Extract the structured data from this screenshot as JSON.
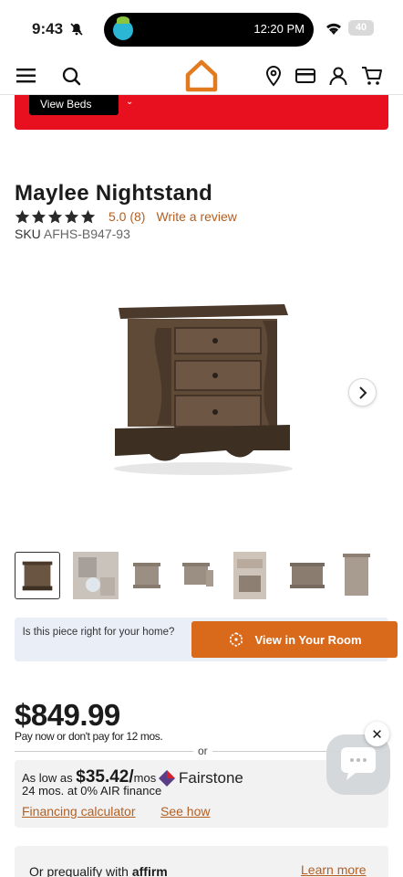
{
  "status_bar": {
    "time": "9:43",
    "island_time": "12:20 PM",
    "battery": "40"
  },
  "nav": {
    "icons": [
      "menu-icon",
      "search-icon",
      "home-logo-icon",
      "location-pin-icon",
      "credit-card-icon",
      "account-icon",
      "cart-icon"
    ],
    "brand_color": "#e27a1f"
  },
  "promo": {
    "button_label": "View Beds",
    "bg_color": "#e8101f"
  },
  "product": {
    "title": "Maylee Nightstand",
    "rating_text": "5.0 (8)",
    "stars": 5,
    "write_review": "Write a review",
    "sku_label": "SKU",
    "sku_value": "AFHS-B947-93"
  },
  "room": {
    "question": "Is this piece right for your home?",
    "button_label": "View in Your Room"
  },
  "pricing": {
    "price": "$849.99",
    "pay_note": "Pay now or don't pay for 12 mos.",
    "or": "or",
    "as_low_as": "As low as",
    "monthly": "$35.42/",
    "per": "mos",
    "terms": "24 mos. at 0% AIR finance",
    "fairstone": "Fairstone",
    "financing_calculator": "Financing calculator",
    "see_how": "See how"
  },
  "prequal": {
    "text": "Or prequalify with",
    "brand": "affirm",
    "learn_more": "Learn more"
  },
  "accent_color": "#b35f22",
  "cta_color": "#d9691b"
}
